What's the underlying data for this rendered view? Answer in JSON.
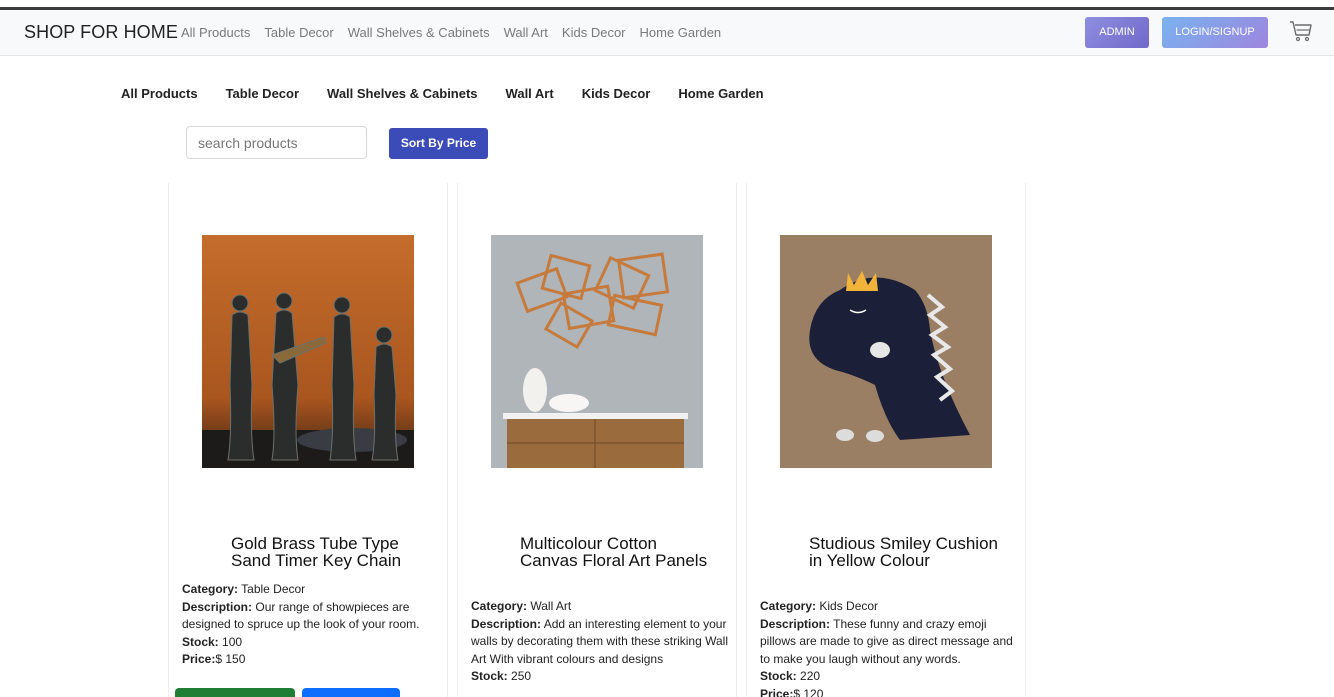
{
  "navbar": {
    "brand": "SHOP FOR HOME",
    "links": [
      "All Products",
      "Table Decor",
      "Wall Shelves & Cabinets",
      "Wall Art",
      "Kids Decor",
      "Home Garden"
    ],
    "admin_label": "ADMIN",
    "login_label": "LOGIN/SIGNUP",
    "cart_icon": "cart-icon"
  },
  "categories": [
    "All Products",
    "Table Decor",
    "Wall Shelves & Cabinets",
    "Wall Art",
    "Kids Decor",
    "Home Garden"
  ],
  "search": {
    "placeholder": "search products",
    "sort_label": "Sort By Price"
  },
  "labels": {
    "category": "Category:",
    "description": "Description:",
    "stock": "Stock:",
    "price": "Price:"
  },
  "products": [
    {
      "title": "Gold Brass Tube Type Sand Timer Key Chain",
      "category": "Table Decor",
      "description": "Our range of showpieces are designed to spruce up the look of your room.",
      "stock": "100",
      "price": "$ 150"
    },
    {
      "title": "Multicolour Cotton Canvas Floral Art Panels",
      "category": "Wall Art",
      "description": "Add an interesting element to your walls by decorating them with these striking Wall Art With vibrant colours and designs",
      "stock": "250",
      "price": ""
    },
    {
      "title": "Studious Smiley Cushion in Yellow Colour",
      "category": "Kids Decor",
      "description": "These funny and crazy emoji pillows are made to give as direct message and to make you laugh without any words.",
      "stock": "220",
      "price": "$ 120"
    }
  ],
  "colors": {
    "sort_button": "#3b4cb8",
    "green_button": "#1e7e34",
    "blue_button": "#0d6efd"
  }
}
